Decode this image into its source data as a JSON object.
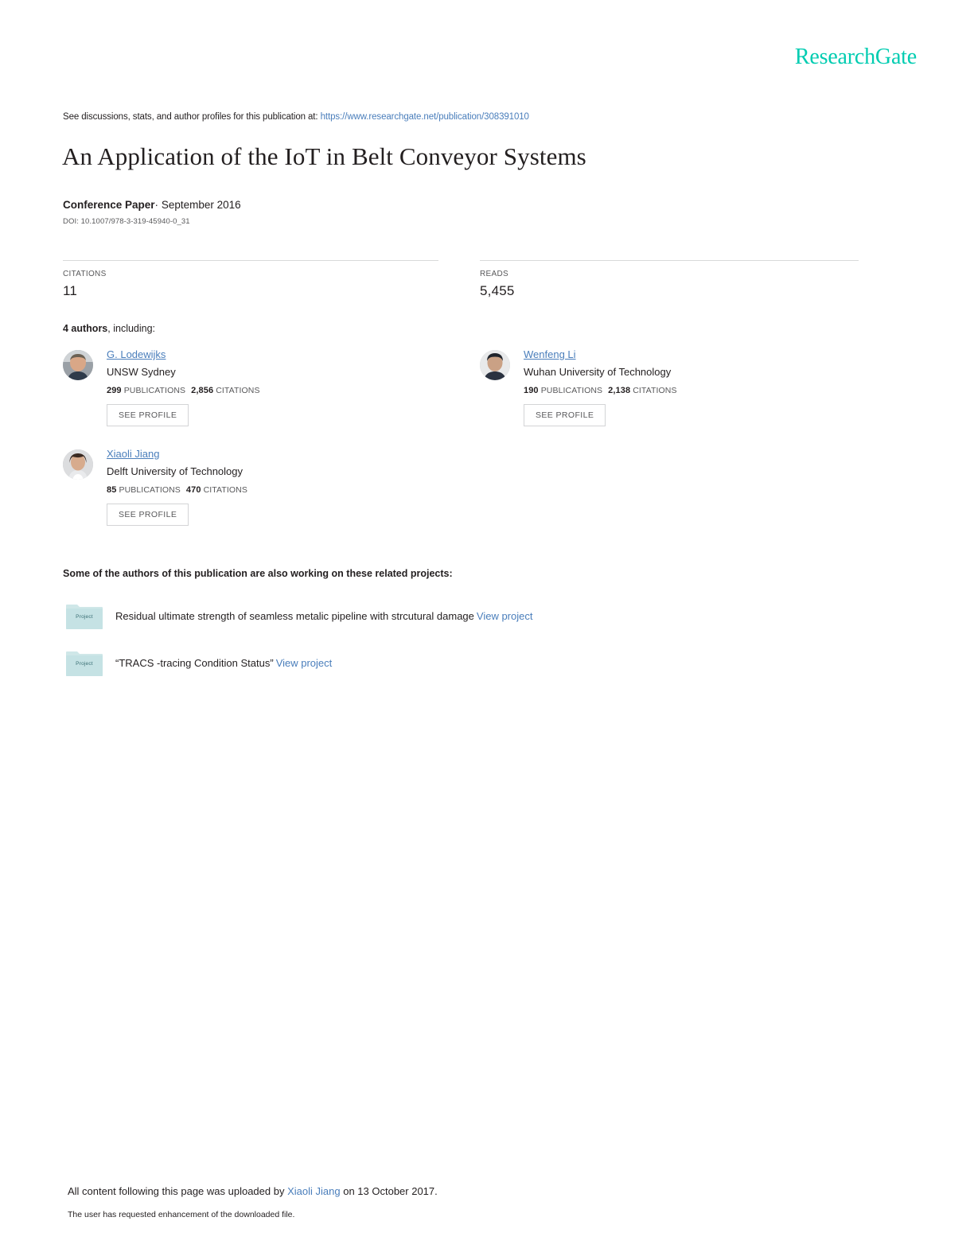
{
  "brand": {
    "name": "ResearchGate",
    "color": "#00ccb1"
  },
  "header": {
    "discussion_prefix": "See discussions, stats, and author profiles for this publication at:",
    "publication_url": "https://www.researchgate.net/publication/308391010"
  },
  "publication": {
    "title": "An Application of the IoT in Belt Conveyor Systems",
    "type": "Conference Paper",
    "date_separator": "·",
    "date": "September 2016",
    "doi": "DOI: 10.1007/978-3-319-45940-0_31"
  },
  "stats": {
    "citations": {
      "label": "CITATIONS",
      "value": "11"
    },
    "reads": {
      "label": "READS",
      "value": "5,455"
    }
  },
  "authors_section": {
    "count_text": "4 authors",
    "including_text": ", including:",
    "see_profile_label": "SEE PROFILE",
    "publications_label": "PUBLICATIONS",
    "citations_label": "CITATIONS",
    "authors": [
      {
        "name": "G. Lodewijks",
        "affiliation": "UNSW Sydney",
        "publications": "299",
        "citations": "2,856",
        "avatar": "male-avatar-photo"
      },
      {
        "name": "Wenfeng Li",
        "affiliation": "Wuhan University of Technology",
        "publications": "190",
        "citations": "2,138",
        "avatar": "male-avatar-photo"
      },
      {
        "name": "Xiaoli Jiang",
        "affiliation": "Delft University of Technology",
        "publications": "85",
        "citations": "470",
        "avatar": "female-avatar-photo"
      }
    ]
  },
  "projects_section": {
    "heading": "Some of the authors of this publication are also working on these related projects:",
    "folder_label": "Project",
    "view_project_label": "View project",
    "projects": [
      {
        "title": "Residual ultimate strength of seamless metalic pipeline with strcutural damage"
      },
      {
        "title": "“TRACS -tracing Condition Status”"
      }
    ]
  },
  "footer": {
    "upload_prefix": "All content following this page was uploaded by",
    "uploader": "Xiaoli Jiang",
    "upload_suffix": "on 13 October 2017.",
    "enhancement_note": "The user has requested enhancement of the downloaded file."
  }
}
